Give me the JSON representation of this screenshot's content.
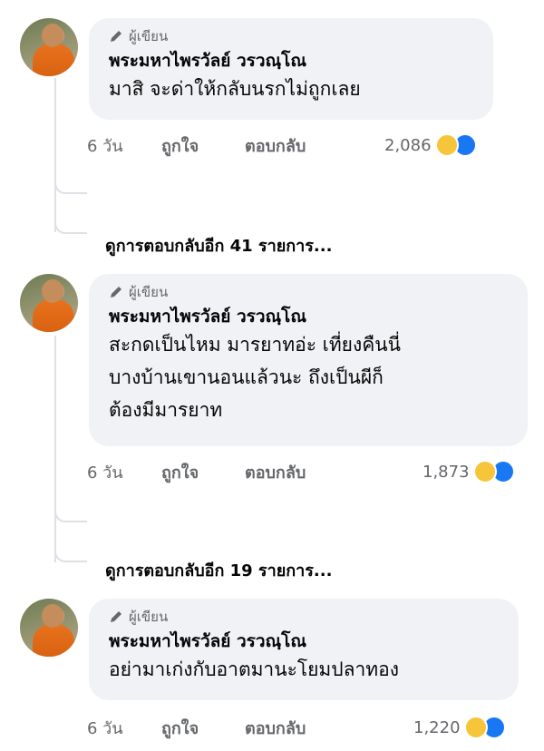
{
  "comments": [
    {
      "author_badge": "ผู้เขียน",
      "name": "พระมหาไพรวัลย์ วรวณฺโณ",
      "lines": [
        "มาสิ จะด่าให้กลับนรกไม่ถูกเลย"
      ],
      "time": "6 วัน",
      "like": "ถูกใจ",
      "reply": "ตอบกลับ",
      "reactions": "2,086",
      "more_replies": "ดูการตอบกลับอีก 41 รายการ..."
    },
    {
      "author_badge": "ผู้เขียน",
      "name": "พระมหาไพรวัลย์ วรวณฺโณ",
      "lines": [
        "สะกดเป็นไหม มารยาทอ่ะ เที่ยงคืนนี่",
        "บางบ้านเขานอนแล้วนะ ถึงเป็นผีก็",
        "ต้องมีมารยาท"
      ],
      "time": "6 วัน",
      "like": "ถูกใจ",
      "reply": "ตอบกลับ",
      "reactions": "1,873",
      "more_replies": "ดูการตอบกลับอีก 19 รายการ..."
    },
    {
      "author_badge": "ผู้เขียน",
      "name": "พระมหาไพรวัลย์ วรวณฺโณ",
      "lines": [
        "อย่ามาเก่งกับอาตมานะโยมปลาทอง"
      ],
      "time": "6 วัน",
      "like": "ถูกใจ",
      "reply": "ตอบกลับ",
      "reactions": "1,220"
    }
  ],
  "reaction_icons": [
    "haha-emoji-icon",
    "like-thumb-icon"
  ],
  "colors": {
    "bubble": "#f0f2f5",
    "meta": "#65676b",
    "like_blue": "#1877f2",
    "haha_yellow": "#f7c53a"
  }
}
